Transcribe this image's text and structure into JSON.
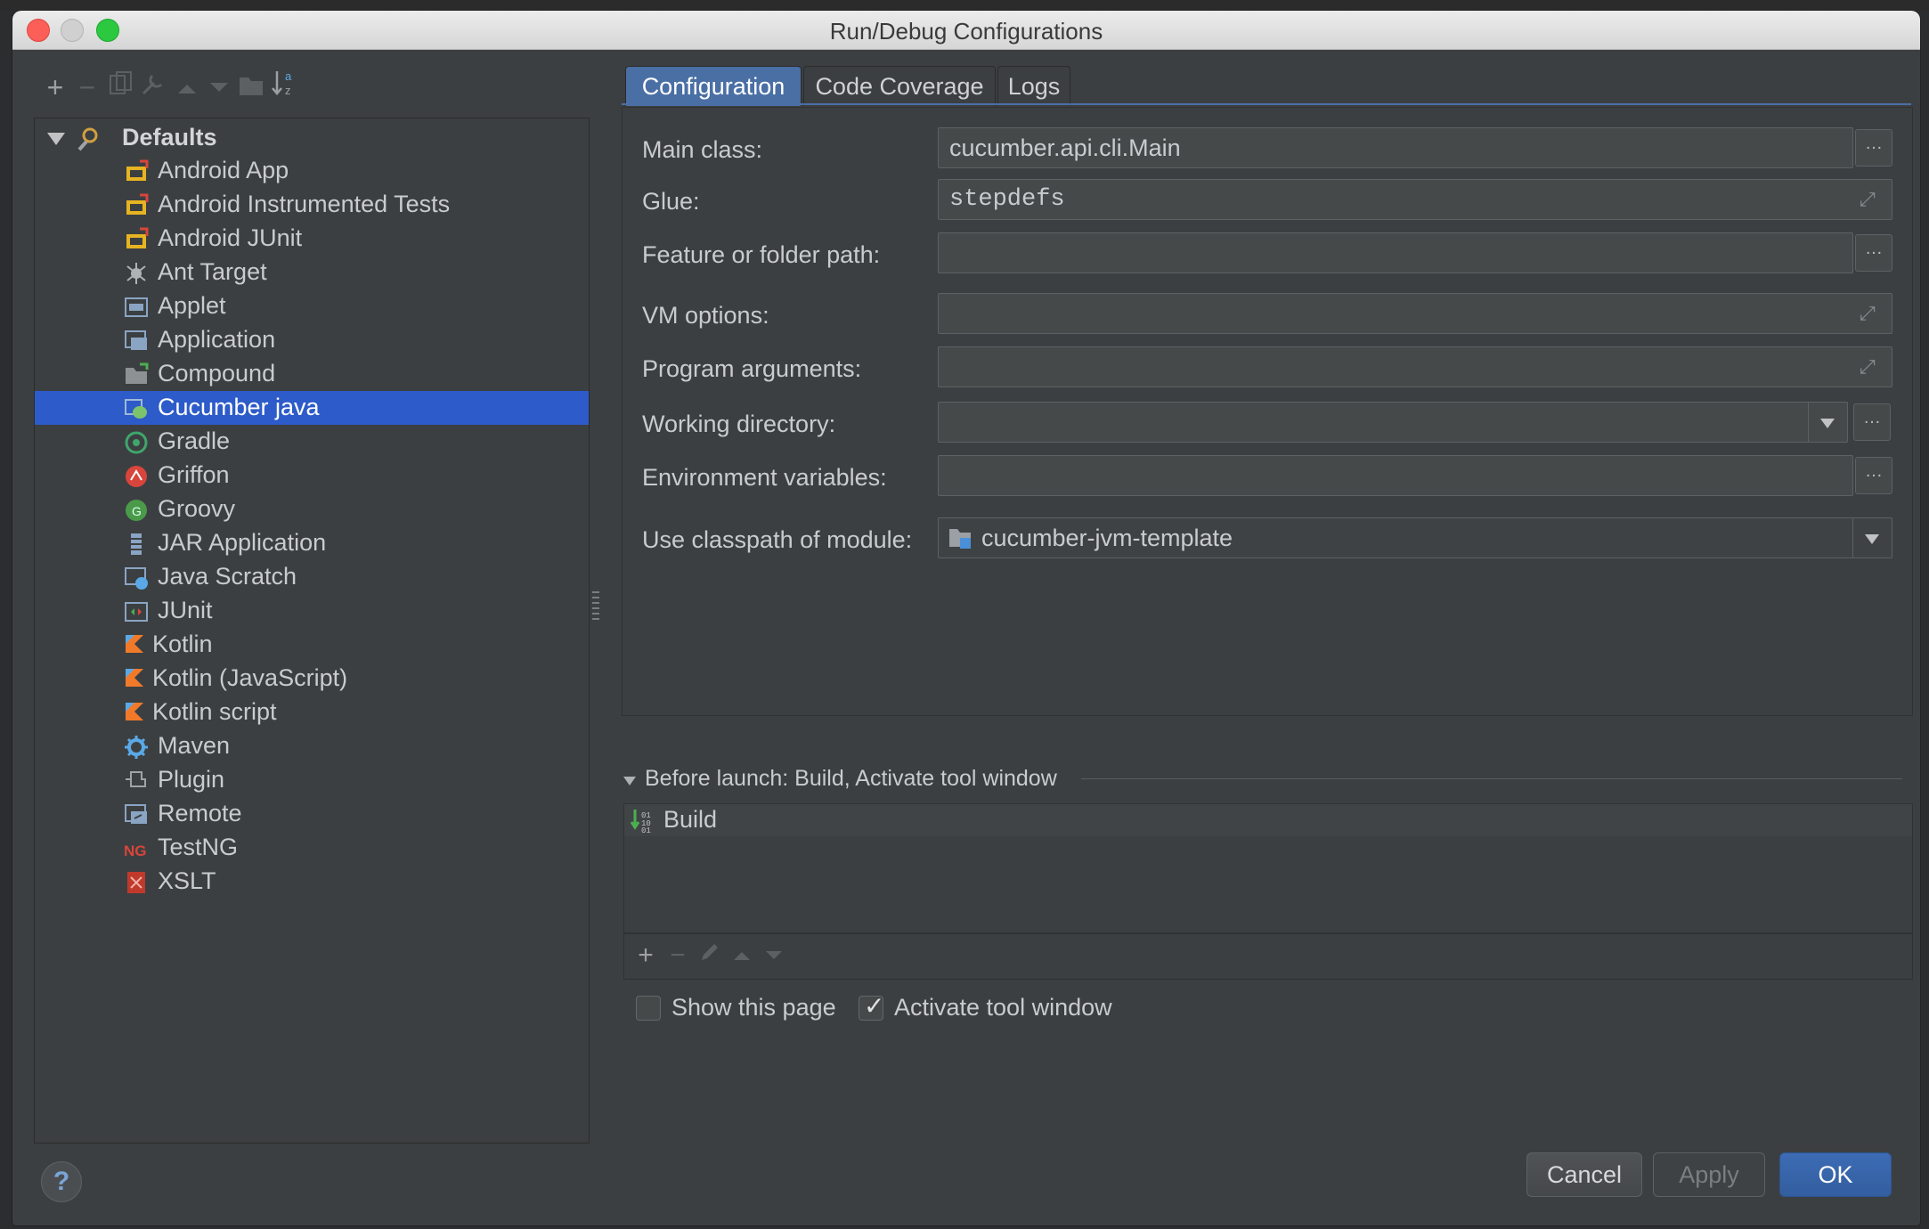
{
  "window": {
    "title": "Run/Debug Configurations"
  },
  "left_toolbar": {
    "items": [
      "add-icon",
      "remove-icon",
      "copy-icon",
      "edit-defaults-icon",
      "move-up-icon",
      "move-down-icon",
      "folder-icon",
      "sort-icon"
    ]
  },
  "tree": {
    "root": "Defaults",
    "items": [
      {
        "label": "Android App",
        "icon": "android-icon",
        "color": "#e6b422"
      },
      {
        "label": "Android Instrumented Tests",
        "icon": "android-icon",
        "color": "#e6b422"
      },
      {
        "label": "Android JUnit",
        "icon": "android-icon",
        "color": "#e6b422"
      },
      {
        "label": "Ant Target",
        "icon": "ant-icon",
        "color": "#b0b3b6"
      },
      {
        "label": "Applet",
        "icon": "applet-icon",
        "color": "#8aa4c4"
      },
      {
        "label": "Application",
        "icon": "application-icon",
        "color": "#8aa4c4"
      },
      {
        "label": "Compound",
        "icon": "compound-icon",
        "color": "#8e9194"
      },
      {
        "label": "Cucumber java",
        "icon": "cucumber-icon",
        "color": "#7cc36b"
      },
      {
        "label": "Gradle",
        "icon": "gradle-icon",
        "color": "#3fa66b"
      },
      {
        "label": "Griffon",
        "icon": "griffon-icon",
        "color": "#d8453c"
      },
      {
        "label": "Groovy",
        "icon": "groovy-icon",
        "color": "#4a9a4a"
      },
      {
        "label": "JAR Application",
        "icon": "jar-icon",
        "color": "#8aa4c4"
      },
      {
        "label": "Java Scratch",
        "icon": "java-scratch-icon",
        "color": "#8aa4c4"
      },
      {
        "label": "JUnit",
        "icon": "junit-icon",
        "color": "#8aa4c4"
      },
      {
        "label": "Kotlin",
        "icon": "kotlin-icon",
        "color": "#f07a2a"
      },
      {
        "label": "Kotlin (JavaScript)",
        "icon": "kotlin-icon",
        "color": "#f07a2a"
      },
      {
        "label": "Kotlin script",
        "icon": "kotlin-icon",
        "color": "#f07a2a"
      },
      {
        "label": "Maven",
        "icon": "maven-icon",
        "color": "#5aa9e6"
      },
      {
        "label": "Plugin",
        "icon": "plugin-icon",
        "color": "#a0a3a6"
      },
      {
        "label": "Remote",
        "icon": "remote-icon",
        "color": "#8aa4c4"
      },
      {
        "label": "TestNG",
        "icon": "testng-icon",
        "color": "#d8453c"
      },
      {
        "label": "XSLT",
        "icon": "xslt-icon",
        "color": "#c0392b"
      }
    ],
    "selected": "Cucumber java"
  },
  "tabs": [
    {
      "label": "Configuration",
      "active": true
    },
    {
      "label": "Code Coverage",
      "active": false
    },
    {
      "label": "Logs",
      "active": false
    }
  ],
  "fields": {
    "main_class": {
      "label": "Main class:",
      "value": "cucumber.api.cli.Main"
    },
    "glue": {
      "label": "Glue:",
      "value": "stepdefs"
    },
    "feature_path": {
      "label": "Feature or folder path:",
      "value": ""
    },
    "vm_options": {
      "label": "VM options:",
      "value": ""
    },
    "program_arguments": {
      "label": "Program arguments:",
      "value": ""
    },
    "working_directory": {
      "label": "Working directory:",
      "value": ""
    },
    "environment_variables": {
      "label": "Environment variables:",
      "value": ""
    },
    "classpath_module": {
      "label": "Use classpath of module:",
      "value": "cucumber-jvm-template"
    }
  },
  "before_launch": {
    "header": "Before launch: Build, Activate tool window",
    "tasks": [
      "Build"
    ]
  },
  "options": {
    "show_page": {
      "label": "Show this page",
      "checked": false
    },
    "activate_tool_window": {
      "label": "Activate tool window",
      "checked": true
    }
  },
  "buttons": {
    "help": "?",
    "cancel": "Cancel",
    "apply": "Apply",
    "ok": "OK"
  },
  "colors": {
    "selection": "#2d5bc9",
    "ok_button": "#3a66ad"
  }
}
